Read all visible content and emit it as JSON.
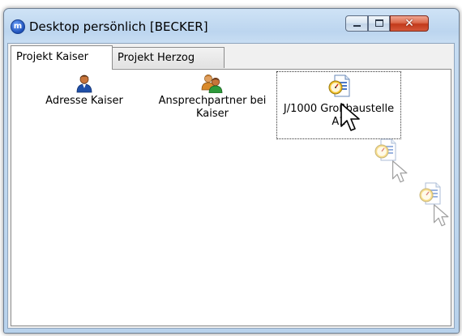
{
  "window": {
    "title": "Desktop persönlich [BECKER]",
    "logo_letter": "m",
    "controls": {
      "minimize_icon": "minimize-icon",
      "maximize_icon": "maximize-icon",
      "close_icon": "close-icon",
      "close_glyph": "✕"
    }
  },
  "tabs": [
    {
      "label": "Projekt Kaiser",
      "active": true
    },
    {
      "label": "Projekt Herzog",
      "active": false
    }
  ],
  "desktop_items": [
    {
      "label": "Adresse Kaiser",
      "icon": "person-icon"
    },
    {
      "label": "Ansprechpartner bei Kaiser",
      "icon": "contacts-icon"
    },
    {
      "label": "J/1000 Großbaustelle A1",
      "icon": "project-document-icon",
      "selected": true
    }
  ],
  "drag_ghosts": [
    {
      "icon": "project-document-icon"
    },
    {
      "icon": "project-document-icon"
    }
  ],
  "colors": {
    "title_bar": "#c3daf2",
    "close_button": "#d5583a",
    "tab_active": "#ffffff"
  }
}
